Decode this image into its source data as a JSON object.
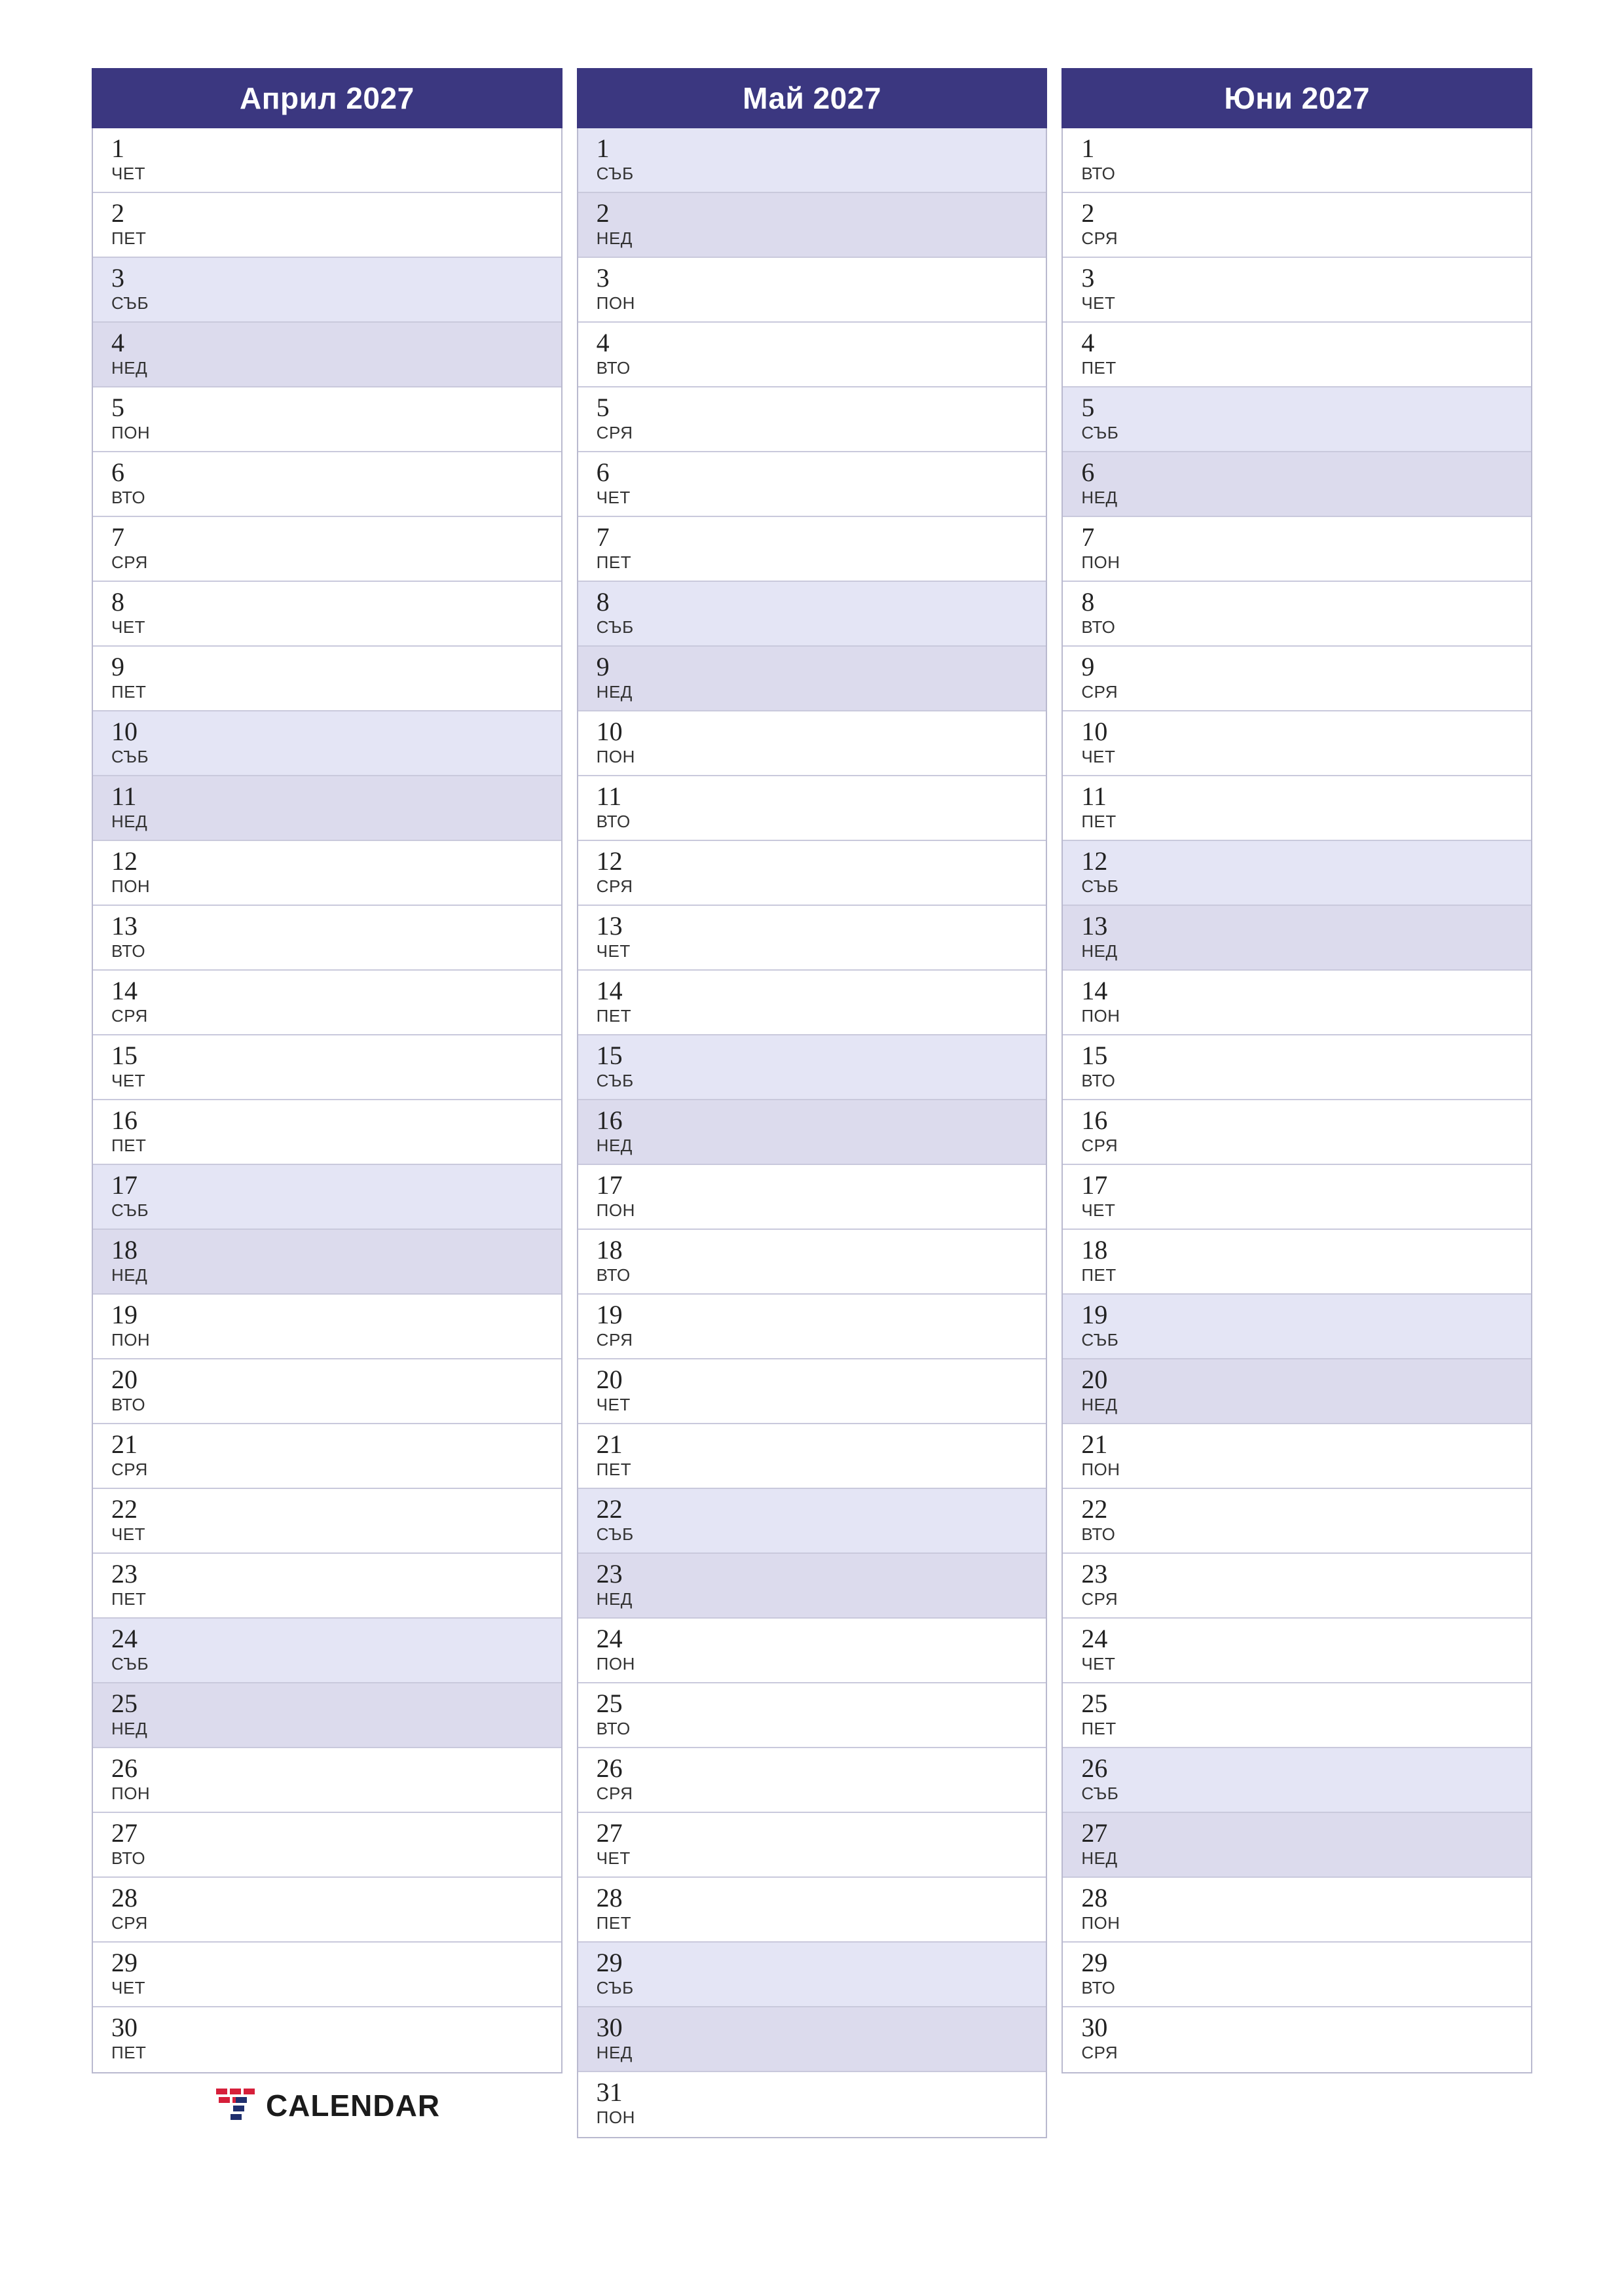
{
  "brand": {
    "name": "CALENDAR",
    "mark_colors": [
      "#d61f3a",
      "#1f2f6e"
    ]
  },
  "colors": {
    "header_bg": "#3b3780",
    "header_text": "#ffffff",
    "saturday_bg": "#e4e5f5",
    "sunday_bg": "#dcdbed",
    "grid_border": "#c9c9dc"
  },
  "months": [
    {
      "title": "Април 2027",
      "days": [
        {
          "num": "1",
          "wd": "ЧЕТ",
          "type": "weekday"
        },
        {
          "num": "2",
          "wd": "ПЕТ",
          "type": "weekday"
        },
        {
          "num": "3",
          "wd": "СЪБ",
          "type": "sat"
        },
        {
          "num": "4",
          "wd": "НЕД",
          "type": "sun"
        },
        {
          "num": "5",
          "wd": "ПОН",
          "type": "weekday"
        },
        {
          "num": "6",
          "wd": "ВТО",
          "type": "weekday"
        },
        {
          "num": "7",
          "wd": "СРЯ",
          "type": "weekday"
        },
        {
          "num": "8",
          "wd": "ЧЕТ",
          "type": "weekday"
        },
        {
          "num": "9",
          "wd": "ПЕТ",
          "type": "weekday"
        },
        {
          "num": "10",
          "wd": "СЪБ",
          "type": "sat"
        },
        {
          "num": "11",
          "wd": "НЕД",
          "type": "sun"
        },
        {
          "num": "12",
          "wd": "ПОН",
          "type": "weekday"
        },
        {
          "num": "13",
          "wd": "ВТО",
          "type": "weekday"
        },
        {
          "num": "14",
          "wd": "СРЯ",
          "type": "weekday"
        },
        {
          "num": "15",
          "wd": "ЧЕТ",
          "type": "weekday"
        },
        {
          "num": "16",
          "wd": "ПЕТ",
          "type": "weekday"
        },
        {
          "num": "17",
          "wd": "СЪБ",
          "type": "sat"
        },
        {
          "num": "18",
          "wd": "НЕД",
          "type": "sun"
        },
        {
          "num": "19",
          "wd": "ПОН",
          "type": "weekday"
        },
        {
          "num": "20",
          "wd": "ВТО",
          "type": "weekday"
        },
        {
          "num": "21",
          "wd": "СРЯ",
          "type": "weekday"
        },
        {
          "num": "22",
          "wd": "ЧЕТ",
          "type": "weekday"
        },
        {
          "num": "23",
          "wd": "ПЕТ",
          "type": "weekday"
        },
        {
          "num": "24",
          "wd": "СЪБ",
          "type": "sat"
        },
        {
          "num": "25",
          "wd": "НЕД",
          "type": "sun"
        },
        {
          "num": "26",
          "wd": "ПОН",
          "type": "weekday"
        },
        {
          "num": "27",
          "wd": "ВТО",
          "type": "weekday"
        },
        {
          "num": "28",
          "wd": "СРЯ",
          "type": "weekday"
        },
        {
          "num": "29",
          "wd": "ЧЕТ",
          "type": "weekday"
        },
        {
          "num": "30",
          "wd": "ПЕТ",
          "type": "weekday"
        }
      ]
    },
    {
      "title": "Май 2027",
      "days": [
        {
          "num": "1",
          "wd": "СЪБ",
          "type": "sat"
        },
        {
          "num": "2",
          "wd": "НЕД",
          "type": "sun"
        },
        {
          "num": "3",
          "wd": "ПОН",
          "type": "weekday"
        },
        {
          "num": "4",
          "wd": "ВТО",
          "type": "weekday"
        },
        {
          "num": "5",
          "wd": "СРЯ",
          "type": "weekday"
        },
        {
          "num": "6",
          "wd": "ЧЕТ",
          "type": "weekday"
        },
        {
          "num": "7",
          "wd": "ПЕТ",
          "type": "weekday"
        },
        {
          "num": "8",
          "wd": "СЪБ",
          "type": "sat"
        },
        {
          "num": "9",
          "wd": "НЕД",
          "type": "sun"
        },
        {
          "num": "10",
          "wd": "ПОН",
          "type": "weekday"
        },
        {
          "num": "11",
          "wd": "ВТО",
          "type": "weekday"
        },
        {
          "num": "12",
          "wd": "СРЯ",
          "type": "weekday"
        },
        {
          "num": "13",
          "wd": "ЧЕТ",
          "type": "weekday"
        },
        {
          "num": "14",
          "wd": "ПЕТ",
          "type": "weekday"
        },
        {
          "num": "15",
          "wd": "СЪБ",
          "type": "sat"
        },
        {
          "num": "16",
          "wd": "НЕД",
          "type": "sun"
        },
        {
          "num": "17",
          "wd": "ПОН",
          "type": "weekday"
        },
        {
          "num": "18",
          "wd": "ВТО",
          "type": "weekday"
        },
        {
          "num": "19",
          "wd": "СРЯ",
          "type": "weekday"
        },
        {
          "num": "20",
          "wd": "ЧЕТ",
          "type": "weekday"
        },
        {
          "num": "21",
          "wd": "ПЕТ",
          "type": "weekday"
        },
        {
          "num": "22",
          "wd": "СЪБ",
          "type": "sat"
        },
        {
          "num": "23",
          "wd": "НЕД",
          "type": "sun"
        },
        {
          "num": "24",
          "wd": "ПОН",
          "type": "weekday"
        },
        {
          "num": "25",
          "wd": "ВТО",
          "type": "weekday"
        },
        {
          "num": "26",
          "wd": "СРЯ",
          "type": "weekday"
        },
        {
          "num": "27",
          "wd": "ЧЕТ",
          "type": "weekday"
        },
        {
          "num": "28",
          "wd": "ПЕТ",
          "type": "weekday"
        },
        {
          "num": "29",
          "wd": "СЪБ",
          "type": "sat"
        },
        {
          "num": "30",
          "wd": "НЕД",
          "type": "sun"
        },
        {
          "num": "31",
          "wd": "ПОН",
          "type": "weekday"
        }
      ]
    },
    {
      "title": "Юни 2027",
      "days": [
        {
          "num": "1",
          "wd": "ВТО",
          "type": "weekday"
        },
        {
          "num": "2",
          "wd": "СРЯ",
          "type": "weekday"
        },
        {
          "num": "3",
          "wd": "ЧЕТ",
          "type": "weekday"
        },
        {
          "num": "4",
          "wd": "ПЕТ",
          "type": "weekday"
        },
        {
          "num": "5",
          "wd": "СЪБ",
          "type": "sat"
        },
        {
          "num": "6",
          "wd": "НЕД",
          "type": "sun"
        },
        {
          "num": "7",
          "wd": "ПОН",
          "type": "weekday"
        },
        {
          "num": "8",
          "wd": "ВТО",
          "type": "weekday"
        },
        {
          "num": "9",
          "wd": "СРЯ",
          "type": "weekday"
        },
        {
          "num": "10",
          "wd": "ЧЕТ",
          "type": "weekday"
        },
        {
          "num": "11",
          "wd": "ПЕТ",
          "type": "weekday"
        },
        {
          "num": "12",
          "wd": "СЪБ",
          "type": "sat"
        },
        {
          "num": "13",
          "wd": "НЕД",
          "type": "sun"
        },
        {
          "num": "14",
          "wd": "ПОН",
          "type": "weekday"
        },
        {
          "num": "15",
          "wd": "ВТО",
          "type": "weekday"
        },
        {
          "num": "16",
          "wd": "СРЯ",
          "type": "weekday"
        },
        {
          "num": "17",
          "wd": "ЧЕТ",
          "type": "weekday"
        },
        {
          "num": "18",
          "wd": "ПЕТ",
          "type": "weekday"
        },
        {
          "num": "19",
          "wd": "СЪБ",
          "type": "sat"
        },
        {
          "num": "20",
          "wd": "НЕД",
          "type": "sun"
        },
        {
          "num": "21",
          "wd": "ПОН",
          "type": "weekday"
        },
        {
          "num": "22",
          "wd": "ВТО",
          "type": "weekday"
        },
        {
          "num": "23",
          "wd": "СРЯ",
          "type": "weekday"
        },
        {
          "num": "24",
          "wd": "ЧЕТ",
          "type": "weekday"
        },
        {
          "num": "25",
          "wd": "ПЕТ",
          "type": "weekday"
        },
        {
          "num": "26",
          "wd": "СЪБ",
          "type": "sat"
        },
        {
          "num": "27",
          "wd": "НЕД",
          "type": "sun"
        },
        {
          "num": "28",
          "wd": "ПОН",
          "type": "weekday"
        },
        {
          "num": "29",
          "wd": "ВТО",
          "type": "weekday"
        },
        {
          "num": "30",
          "wd": "СРЯ",
          "type": "weekday"
        }
      ]
    }
  ]
}
